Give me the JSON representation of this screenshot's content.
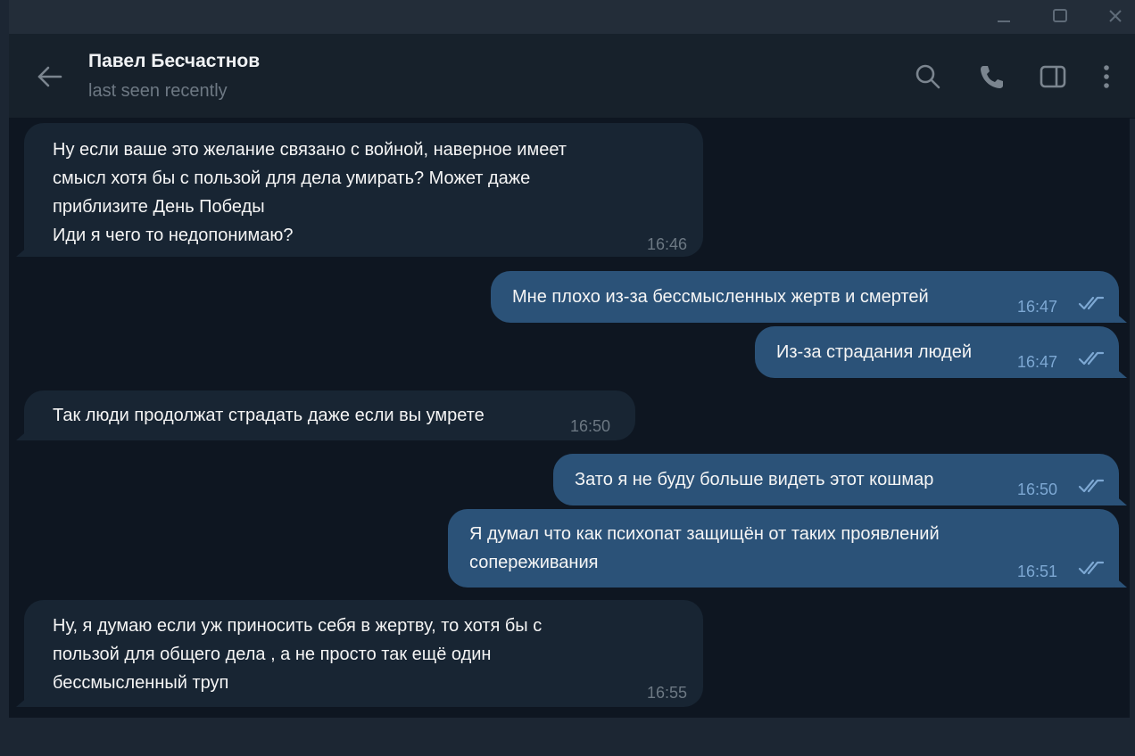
{
  "window": {
    "minimize_icon": "minimize-icon",
    "maximize_icon": "maximize-icon",
    "close_icon": "close-icon"
  },
  "header": {
    "contact_name": "Павел Бесчастнов",
    "status": "last seen recently",
    "icons": [
      "back-arrow-icon",
      "search-icon",
      "phone-icon",
      "sidebar-toggle-icon",
      "more-vertical-icon"
    ]
  },
  "colors": {
    "incoming_bubble": "#182533",
    "outgoing_bubble": "#2b5278",
    "chat_background": "#0e1621",
    "read_ticks": "#7da8d3"
  },
  "messages": [
    {
      "direction": "incoming",
      "text": "Ну если ваше это желание связано с войной, наверное имеет\nсмысл хотя бы с пользой для дела умирать? Может даже\nприблизите День Победы\nИди я чего то недопонимаю?",
      "time": "16:46"
    },
    {
      "direction": "outgoing",
      "text": "Мне плохо из-за бессмысленных жертв и смертей",
      "time": "16:47",
      "status": "read"
    },
    {
      "direction": "outgoing",
      "text": "Из-за страдания людей",
      "time": "16:47",
      "status": "read"
    },
    {
      "direction": "incoming",
      "text": "Так люди продолжат страдать даже если вы умрете",
      "time": "16:50"
    },
    {
      "direction": "outgoing",
      "text": "Зато я не буду больше видеть этот кошмар",
      "time": "16:50",
      "status": "read"
    },
    {
      "direction": "outgoing",
      "text": "Я думал что как психопат защищён от таких проявлений\nсопереживания",
      "time": "16:51",
      "status": "read"
    },
    {
      "direction": "incoming",
      "text": "Ну, я думаю если уж приносить себя в жертву, то хотя бы с\nпользой для общего дела , а не просто так ещё один\nбессмысленный труп",
      "time": "16:55"
    }
  ]
}
